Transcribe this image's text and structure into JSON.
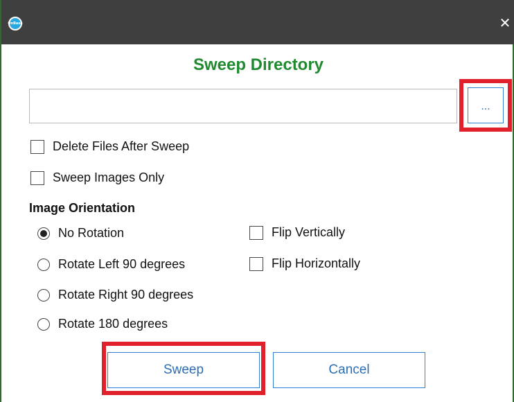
{
  "window": {
    "app_icon_text": "OnBase",
    "close_symbol": "✕"
  },
  "dialog": {
    "title": "Sweep Directory",
    "path_value": "",
    "browse_label": "..."
  },
  "options": {
    "delete_files_after_sweep": {
      "label": "Delete Files After Sweep",
      "checked": false
    },
    "sweep_images_only": {
      "label": "Sweep Images Only",
      "checked": false
    }
  },
  "orientation": {
    "heading": "Image Orientation",
    "rotations": [
      {
        "label": "No Rotation",
        "selected": true
      },
      {
        "label": "Rotate Left 90 degrees",
        "selected": false
      },
      {
        "label": "Rotate Right 90 degrees",
        "selected": false
      },
      {
        "label": "Rotate 180 degrees",
        "selected": false
      }
    ],
    "flips": [
      {
        "label": "Flip Vertically",
        "checked": false
      },
      {
        "label": "Flip Horizontally",
        "checked": false
      }
    ]
  },
  "buttons": {
    "sweep_label": "Sweep",
    "cancel_label": "Cancel"
  },
  "colors": {
    "title_green": "#1f8a2f",
    "highlight_red": "#e0202a",
    "button_blue": "#2d7fd4",
    "titlebar": "#3f3f3f"
  }
}
